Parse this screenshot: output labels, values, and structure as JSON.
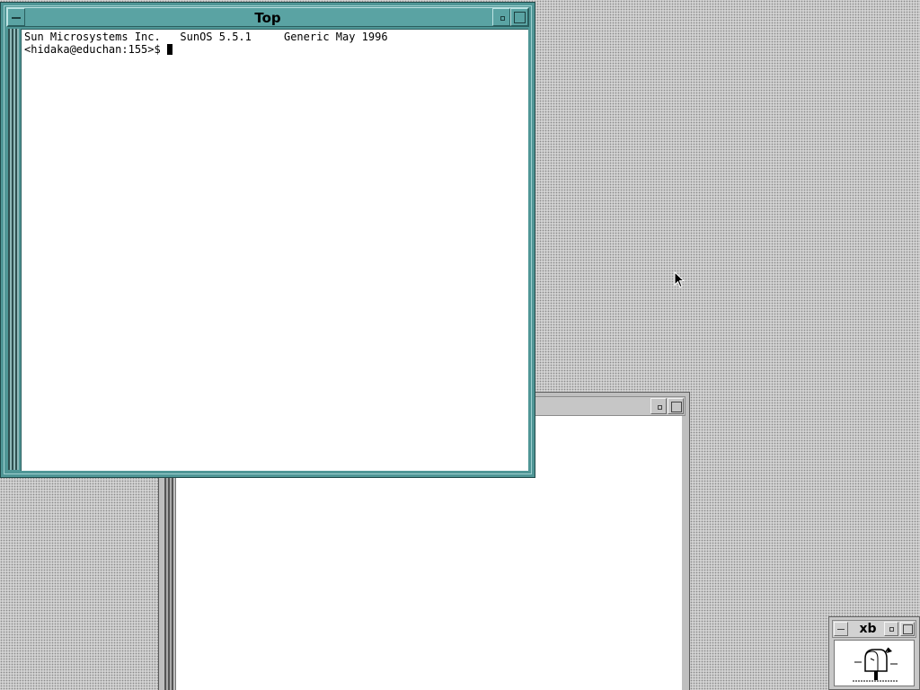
{
  "terminal": {
    "title": "Top",
    "lines": [
      "Sun Microsystems Inc.   SunOS 5.5.1     Generic May 1996",
      "<hidaka@educhan:155>$ "
    ]
  },
  "xbiff": {
    "title": "xb"
  },
  "icons": {
    "window_menu": "window-menu-icon",
    "minimize": "minimize-icon",
    "maximize": "maximize-icon",
    "mailbox": "mailbox-icon",
    "pointer": "mouse-pointer-icon"
  },
  "colors": {
    "active_frame": "#4f9696",
    "inactive_frame": "#c6c6c6",
    "terminal_background": "#ffffff",
    "terminal_text": "#000000"
  }
}
